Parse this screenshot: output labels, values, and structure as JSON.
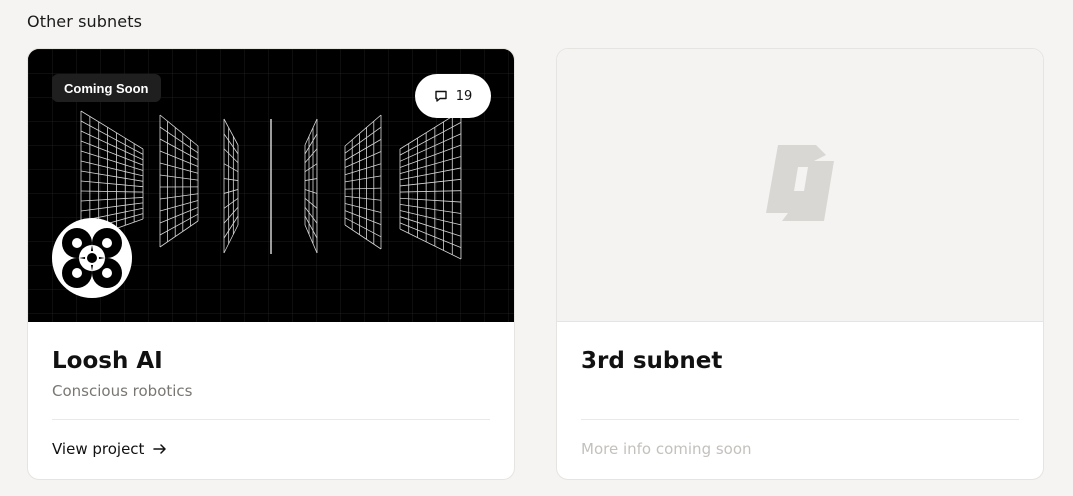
{
  "section": {
    "title": "Other subnets"
  },
  "cards": [
    {
      "badge": "Coming Soon",
      "comments": "19",
      "title": "Loosh AI",
      "subtitle": "Conscious robotics",
      "link_label": "View project",
      "icons": {
        "comment": "comment-icon",
        "arrow": "arrow-right-icon",
        "logo": "loosh-logo"
      }
    },
    {
      "title": "3rd subnet",
      "footer": "More info coming soon",
      "icons": {
        "placeholder": "bittensor-placeholder-logo"
      }
    }
  ]
}
